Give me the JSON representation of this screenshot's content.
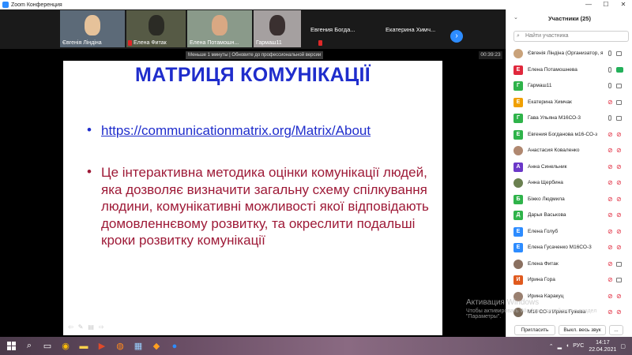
{
  "window": {
    "title": "Zoom Конференция",
    "minimize": "—",
    "maximize": "☐",
    "close": "✕"
  },
  "strip": {
    "tiles": [
      {
        "name": "Євгенія Ліндіна"
      },
      {
        "name": "Елена Фитак"
      },
      {
        "name": "Елена Потамошн..."
      },
      {
        "name": "Гармаш11"
      },
      {
        "name": "Евгения Богда..."
      },
      {
        "name": "Екатерина Химч..."
      }
    ],
    "next_icon": "›"
  },
  "tooltip": "Меньше 1 минуты | Обновите до профессиональной версии",
  "timer": "00:39:23",
  "slide": {
    "title": "МАТРИЦЯ КОМУНІКАЦІЇ",
    "bullet_char": "•",
    "link": "https://communicationmatrix.org/Matrix/About",
    "description": "Це інтерактивна методика оцінки комунікації людей, яка дозволяє визначити загальну схему спілкування людини, комунікативні можливості якої відповідають домовленнєвому розвитку, та окреслити подальші кроки розвитку комунікації",
    "tools": [
      "⇦",
      "✎",
      "▤",
      "⇨"
    ]
  },
  "participants": {
    "title": "Участники (25)",
    "collapse_icon": "⌄",
    "search_placeholder": "Найти участника",
    "list": [
      {
        "initial": "",
        "color": "#c9a27a",
        "photo": true,
        "name": "Євгенія Ліндіна (Организатор, я)",
        "mic": "on",
        "cam": "on"
      },
      {
        "initial": "Е",
        "color": "#e0283c",
        "photo": false,
        "name": "Елена Потамошнева",
        "mic": "on",
        "cam": "share"
      },
      {
        "initial": "Г",
        "color": "#2fb34a",
        "photo": false,
        "name": "Гармаш11",
        "mic": "on",
        "cam": "on"
      },
      {
        "initial": "Е",
        "color": "#f0a000",
        "photo": false,
        "name": "Екатерина Химчак",
        "mic": "off",
        "cam": "on"
      },
      {
        "initial": "Г",
        "color": "#2fb34a",
        "photo": false,
        "name": "Гава Ульяна М16СО-3",
        "mic": "on",
        "cam": "on"
      },
      {
        "initial": "Е",
        "color": "#2fb34a",
        "photo": false,
        "name": "Евгения Богданова м16-СО-з",
        "mic": "off",
        "cam": "off"
      },
      {
        "initial": "",
        "color": "#b08870",
        "photo": true,
        "name": "Анастасия Коваленко",
        "mic": "off",
        "cam": "off"
      },
      {
        "initial": "А",
        "color": "#6b38c8",
        "photo": false,
        "name": "Анна Синельник",
        "mic": "off",
        "cam": "off"
      },
      {
        "initial": "",
        "color": "#6a8050",
        "photo": true,
        "name": "Анна Щербина",
        "mic": "off",
        "cam": "off"
      },
      {
        "initial": "Б",
        "color": "#2fb34a",
        "photo": false,
        "name": "Біжко Людмила",
        "mic": "off",
        "cam": "off"
      },
      {
        "initial": "Д",
        "color": "#2fb34a",
        "photo": false,
        "name": "Дарья Васькова",
        "mic": "off",
        "cam": "off"
      },
      {
        "initial": "Е",
        "color": "#2d8cff",
        "photo": false,
        "name": "Елена Голуб",
        "mic": "off",
        "cam": "off"
      },
      {
        "initial": "Е",
        "color": "#2d8cff",
        "photo": false,
        "name": "Елена Гусаченко М16СО-3",
        "mic": "off",
        "cam": "off"
      },
      {
        "initial": "",
        "color": "#8a7060",
        "photo": true,
        "name": "Елена Фитак",
        "mic": "off",
        "cam": "on"
      },
      {
        "initial": "И",
        "color": "#e05a1e",
        "photo": false,
        "name": "Ирина Гора",
        "mic": "off",
        "cam": "on"
      },
      {
        "initial": "",
        "color": "#9a8070",
        "photo": true,
        "name": "Ирина Каракуц",
        "mic": "off",
        "cam": "off"
      },
      {
        "initial": "",
        "color": "#7a6a5a",
        "photo": true,
        "name": "М16 СО-з Ирина Гужева",
        "mic": "off",
        "cam": "off"
      }
    ],
    "invite": "Пригласить",
    "mute_all": "Выкл. весь звук",
    "more": "..."
  },
  "watermark": {
    "line1": "Активация Windows",
    "line2": "Чтобы активировать Windows, перейдите в раздел",
    "line3": "\"Параметры\"."
  },
  "taskbar": {
    "icons": [
      "search",
      "files",
      "chrome",
      "store",
      "media",
      "firefox",
      "app",
      "zoom"
    ],
    "lang": "РУС",
    "time": "14:17",
    "date": "22.04.2021"
  }
}
